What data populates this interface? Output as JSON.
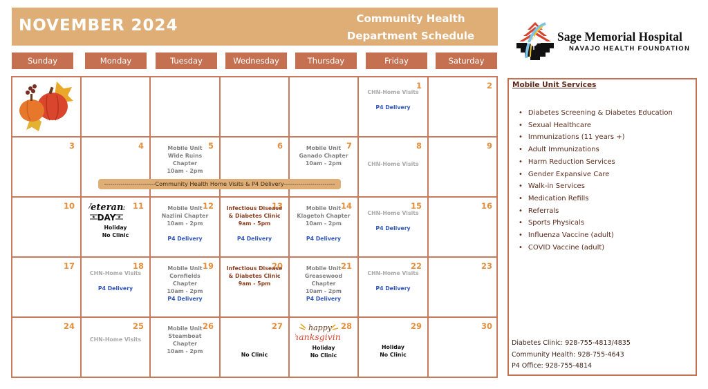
{
  "header": {
    "month_title": "NOVEMBER 2024",
    "dept_title_line1": "Community Health",
    "dept_title_line2": "Department Schedule"
  },
  "colors": {
    "header_bg": "#dfae76",
    "day_header_bg": "#c57050",
    "grid_border": "#c97a5c",
    "day_number": "#e58f3d",
    "delivery_blue": "#2f55b8",
    "clinic_brown": "#8e3f1f",
    "mobile_unit_grey": "#7f7f7f",
    "home_visits_grey": "#a9a9a9",
    "services_text": "#5b2a1a"
  },
  "day_headers": [
    "Sunday",
    "Monday",
    "Tuesday",
    "Wednesday",
    "Thursday",
    "Friday",
    "Saturday"
  ],
  "logo": {
    "icon": "sage-memorial-logo-icon",
    "name": "Sage Memorial Hospital",
    "subtitle": "NAVAJO HEALTH FOUNDATION"
  },
  "banner": {
    "text": "-------------------------Community Health Home Visits & P4 Delivery-------------------------"
  },
  "calendar": {
    "weeks": [
      [
        {
          "day": "",
          "image": "pumpkins-decoration",
          "lines": []
        },
        {
          "day": "",
          "lines": []
        },
        {
          "day": "",
          "lines": []
        },
        {
          "day": "",
          "lines": []
        },
        {
          "day": "",
          "lines": []
        },
        {
          "day": "1",
          "lines": [
            {
              "text": "CHN-Home Visits",
              "style": "light"
            },
            {
              "text": "",
              "style": "gap"
            },
            {
              "text": "P4 Delivery",
              "style": "blue"
            }
          ]
        },
        {
          "day": "2",
          "lines": []
        }
      ],
      [
        {
          "day": "3",
          "lines": []
        },
        {
          "day": "4",
          "lines": []
        },
        {
          "day": "5",
          "lines": [
            {
              "text": "Mobile Unit",
              "style": "grey"
            },
            {
              "text": "Wide Ruins",
              "style": "grey"
            },
            {
              "text": "Chapter",
              "style": "grey"
            },
            {
              "text": "10am - 2pm",
              "style": "grey"
            }
          ]
        },
        {
          "day": "6",
          "lines": []
        },
        {
          "day": "7",
          "lines": [
            {
              "text": "Mobile Unit",
              "style": "grey"
            },
            {
              "text": "Ganado Chapter",
              "style": "grey"
            },
            {
              "text": "10am - 2pm",
              "style": "grey"
            }
          ]
        },
        {
          "day": "8",
          "lines": [
            {
              "text": "CHN-Home Visits",
              "style": "light"
            }
          ]
        },
        {
          "day": "9",
          "lines": []
        }
      ],
      [
        {
          "day": "10",
          "lines": []
        },
        {
          "day": "11",
          "image": "veterans-day-graphic",
          "lines": [
            {
              "text": "Holiday",
              "style": "black"
            },
            {
              "text": "No Clinic",
              "style": "black"
            }
          ]
        },
        {
          "day": "12",
          "lines": [
            {
              "text": "Mobile Unit",
              "style": "grey"
            },
            {
              "text": "Nazlini Chapter",
              "style": "grey"
            },
            {
              "text": "10am - 2pm",
              "style": "grey"
            },
            {
              "text": "",
              "style": "gap"
            },
            {
              "text": "P4 Delivery",
              "style": "blue"
            }
          ]
        },
        {
          "day": "13",
          "lines": [
            {
              "text": "Infectious Disease",
              "style": "brown"
            },
            {
              "text": "& Diabetes Clinic",
              "style": "brown"
            },
            {
              "text": "9am - 5pm",
              "style": "brown"
            },
            {
              "text": "",
              "style": "gap"
            },
            {
              "text": "P4 Delivery",
              "style": "blue"
            }
          ]
        },
        {
          "day": "14",
          "lines": [
            {
              "text": "Mobile Unit",
              "style": "grey"
            },
            {
              "text": "Klagetoh Chapter",
              "style": "grey"
            },
            {
              "text": "10am - 2pm",
              "style": "grey"
            },
            {
              "text": "",
              "style": "gap"
            },
            {
              "text": "P4 Delivery",
              "style": "blue"
            }
          ]
        },
        {
          "day": "15",
          "lines": [
            {
              "text": "CHN-Home Visits",
              "style": "light"
            },
            {
              "text": "",
              "style": "gap"
            },
            {
              "text": "P4 Delivery",
              "style": "blue"
            }
          ]
        },
        {
          "day": "16",
          "lines": []
        }
      ],
      [
        {
          "day": "17",
          "lines": []
        },
        {
          "day": "18",
          "lines": [
            {
              "text": "CHN-Home Visits",
              "style": "light"
            },
            {
              "text": "",
              "style": "gap"
            },
            {
              "text": "P4 Delivery",
              "style": "blue"
            }
          ]
        },
        {
          "day": "19",
          "lines": [
            {
              "text": "Mobile Unit",
              "style": "grey"
            },
            {
              "text": "Cornfields",
              "style": "grey"
            },
            {
              "text": "Chapter",
              "style": "grey"
            },
            {
              "text": "10am - 2pm",
              "style": "grey"
            },
            {
              "text": "P4 Delivery",
              "style": "blue"
            }
          ]
        },
        {
          "day": "20",
          "lines": [
            {
              "text": "Infectious Disease",
              "style": "brown"
            },
            {
              "text": "& Diabetes Clinic",
              "style": "brown"
            },
            {
              "text": "9am - 5pm",
              "style": "brown"
            }
          ]
        },
        {
          "day": "21",
          "lines": [
            {
              "text": "Mobile Unit",
              "style": "grey"
            },
            {
              "text": "Greasewood",
              "style": "grey"
            },
            {
              "text": "Chapter",
              "style": "grey"
            },
            {
              "text": "10am - 2pm",
              "style": "grey"
            },
            {
              "text": "P4 Delivery",
              "style": "blue"
            }
          ]
        },
        {
          "day": "22",
          "lines": [
            {
              "text": "CHN-Home Visits",
              "style": "light"
            },
            {
              "text": "",
              "style": "gap"
            },
            {
              "text": "P4 Delivery",
              "style": "blue"
            }
          ]
        },
        {
          "day": "23",
          "lines": []
        }
      ],
      [
        {
          "day": "24",
          "lines": []
        },
        {
          "day": "25",
          "lines": [
            {
              "text": "",
              "style": "gap"
            },
            {
              "text": "CHN-Home Visits",
              "style": "light"
            }
          ]
        },
        {
          "day": "26",
          "lines": [
            {
              "text": "Mobile Unit",
              "style": "grey"
            },
            {
              "text": "Steamboat",
              "style": "grey"
            },
            {
              "text": "Chapter",
              "style": "grey"
            },
            {
              "text": "10am - 2pm",
              "style": "grey"
            }
          ]
        },
        {
          "day": "27",
          "lines": [
            {
              "text": "",
              "style": "gap"
            },
            {
              "text": "",
              "style": "gap"
            },
            {
              "text": "",
              "style": "gap"
            },
            {
              "text": "No Clinic",
              "style": "black"
            }
          ]
        },
        {
          "day": "28",
          "image": "happy-thanksgiving-graphic",
          "lines": [
            {
              "text": "Holiday",
              "style": "black"
            },
            {
              "text": "No Clinic",
              "style": "black"
            }
          ]
        },
        {
          "day": "29",
          "lines": [
            {
              "text": "",
              "style": "gap"
            },
            {
              "text": "",
              "style": "gap"
            },
            {
              "text": "Holiday",
              "style": "black"
            },
            {
              "text": "No Clinic",
              "style": "black"
            }
          ]
        },
        {
          "day": "30",
          "lines": []
        }
      ]
    ]
  },
  "services": {
    "title": "Mobile Unit Services",
    "items": [
      "Diabetes Screening & Diabetes Education",
      "Sexual Healthcare",
      "Immunizations (11 years +)",
      "Adult Immunizations",
      "Harm Reduction Services",
      "Gender Expansive Care",
      "Walk-in Services",
      "Medication Refills",
      "Referrals",
      "Sports Physicals",
      "Influenza Vaccine (adult)",
      "COVID Vaccine (adult)"
    ],
    "contacts": [
      "Diabetes Clinic: 928-755-4813/4835",
      "Community Health: 928-755-4643",
      "P4 Office: 928-755-4814"
    ]
  }
}
